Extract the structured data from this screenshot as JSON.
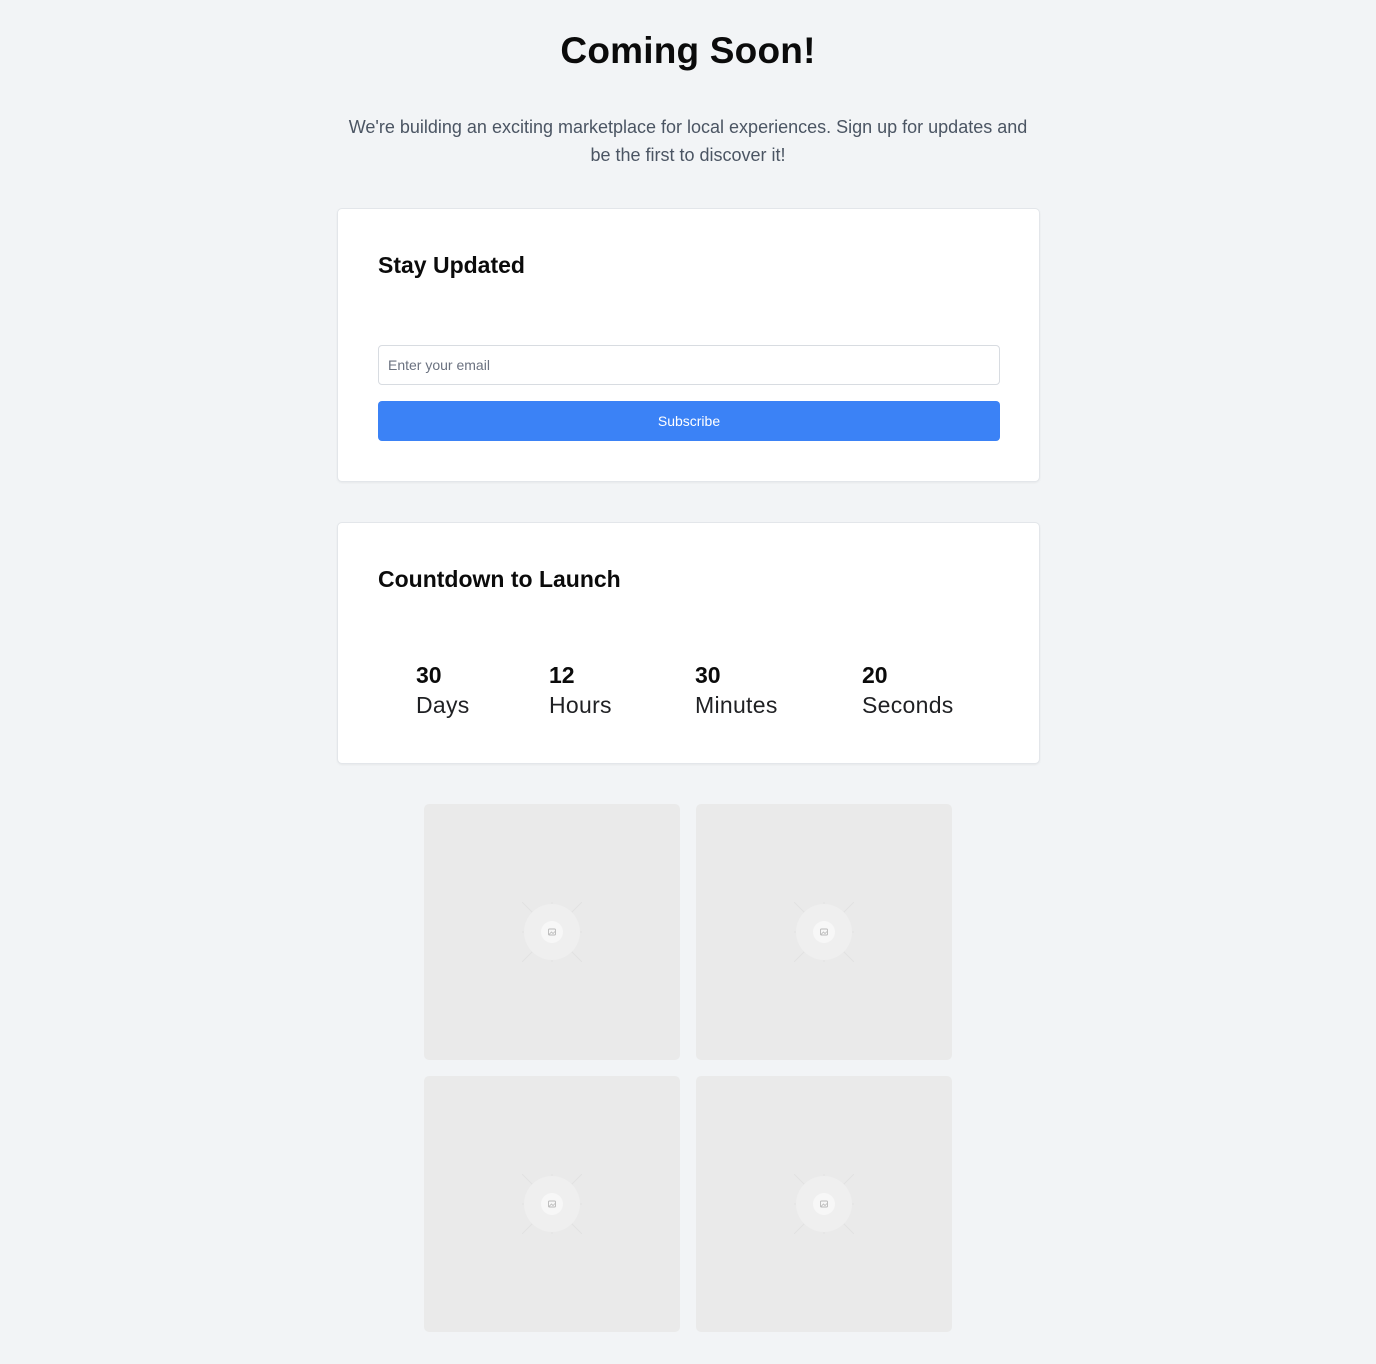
{
  "page": {
    "title": "Coming Soon!",
    "tagline": "We're building an exciting marketplace for local experiences. Sign up for updates and be the first to discover it!"
  },
  "subscribe": {
    "heading": "Stay Updated",
    "email_placeholder": "Enter your email",
    "email_value": "",
    "button_label": "Subscribe"
  },
  "countdown": {
    "heading": "Countdown to Launch",
    "units": [
      {
        "value": "30",
        "label": "Days"
      },
      {
        "value": "12",
        "label": "Hours"
      },
      {
        "value": "30",
        "label": "Minutes"
      },
      {
        "value": "20",
        "label": "Seconds"
      }
    ]
  },
  "gallery": {
    "icon": "image-placeholder-icon"
  },
  "colors": {
    "background": "#f2f4f6",
    "accent": "#3b82f6",
    "card": "#ffffff",
    "tile": "#eaeaea"
  }
}
